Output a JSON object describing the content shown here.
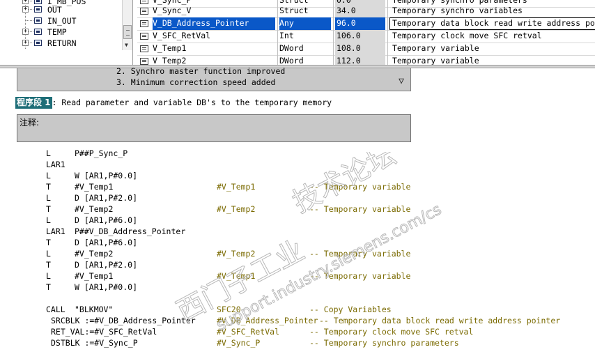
{
  "tree": {
    "items": [
      {
        "label": "I_MB_POS",
        "expander": "+"
      },
      {
        "label": "OUT",
        "expander": "+"
      },
      {
        "label": "IN_OUT",
        "expander": ""
      },
      {
        "label": "TEMP",
        "expander": "+"
      },
      {
        "label": "RETURN",
        "expander": "+"
      }
    ]
  },
  "declarations": {
    "rows": [
      {
        "name": "V_Sync_P",
        "type": "Struct",
        "address": "0.0",
        "comment": "Temporary synchro parameters",
        "selected": false
      },
      {
        "name": "V_Sync_V",
        "type": "Struct",
        "address": "34.0",
        "comment": "Temporary synchro variables",
        "selected": false
      },
      {
        "name": "V_DB_Address_Pointer",
        "type": "Any",
        "address": "96.0",
        "comment": "Temporary data block read write address pointer",
        "selected": true
      },
      {
        "name": "V_SFC_RetVal",
        "type": "Int",
        "address": "106.0",
        "comment": "Temporary clock move SFC retval",
        "selected": false
      },
      {
        "name": "V_Temp1",
        "type": "DWord",
        "address": "108.0",
        "comment": "Temporary variable",
        "selected": false
      },
      {
        "name": "V_Temp2",
        "type": "DWord",
        "address": "112.0",
        "comment": "Temporary variable",
        "selected": false
      }
    ]
  },
  "block_comment": {
    "lines": [
      "2. Synchro master function improved",
      "3. Minimum correction speed added"
    ],
    "toggle_icon": "▽"
  },
  "network": {
    "label": "程序段 1",
    "title": ": Read parameter and variable DB's to the temporary memory",
    "comment_label": "注释:"
  },
  "code": [
    {
      "op": "L",
      "operand": "P##P_Sync_P",
      "symbol": "",
      "comment": ""
    },
    {
      "op": "LAR1",
      "operand": "",
      "symbol": "",
      "comment": ""
    },
    {
      "op": "L",
      "operand": "W [AR1,P#0.0]",
      "symbol": "",
      "comment": ""
    },
    {
      "op": "T",
      "operand": "#V_Temp1",
      "symbol": "#V_Temp1",
      "comment": "-- Temporary variable"
    },
    {
      "op": "L",
      "operand": "D [AR1,P#2.0]",
      "symbol": "",
      "comment": ""
    },
    {
      "op": "T",
      "operand": "#V_Temp2",
      "symbol": "#V_Temp2",
      "comment": "-- Temporary variable"
    },
    {
      "op": "L",
      "operand": "D [AR1,P#6.0]",
      "symbol": "",
      "comment": ""
    },
    {
      "op": "LAR1",
      "operand": "P##V_DB_Address_Pointer",
      "symbol": "",
      "comment": ""
    },
    {
      "op": "T",
      "operand": "D [AR1,P#6.0]",
      "symbol": "",
      "comment": ""
    },
    {
      "op": "L",
      "operand": "#V_Temp2",
      "symbol": "#V_Temp2",
      "comment": "-- Temporary variable"
    },
    {
      "op": "T",
      "operand": "D [AR1,P#2.0]",
      "symbol": "",
      "comment": ""
    },
    {
      "op": "L",
      "operand": "#V_Temp1",
      "symbol": "#V_Temp1",
      "comment": "-- Temporary variable"
    },
    {
      "op": "T",
      "operand": "W [AR1,P#0.0]",
      "symbol": "",
      "comment": ""
    }
  ],
  "call": {
    "op": "CALL",
    "operand": "\"BLKMOV\"",
    "symbol": "SFC20",
    "comment": "-- Copy Variables",
    "params": [
      {
        "text": "SRCBLK :=#V_DB_Address_Pointer",
        "symbol": "#V_DB_Address_Pointer",
        "comment": "-- Temporary data block read write address pointer"
      },
      {
        "text": "RET_VAL:=#V_SFC_RetVal",
        "symbol": "#V_SFC_RetVal",
        "comment": "-- Temporary clock move SFC retval"
      },
      {
        "text": "DSTBLK :=#V_Sync_P",
        "symbol": "#V_Sync_P",
        "comment": "-- Temporary synchro parameters"
      }
    ]
  },
  "watermark": {
    "line1": "西门子工业",
    "line2": "support.industry.siemens.com/cs",
    "line3": "技术论坛"
  }
}
